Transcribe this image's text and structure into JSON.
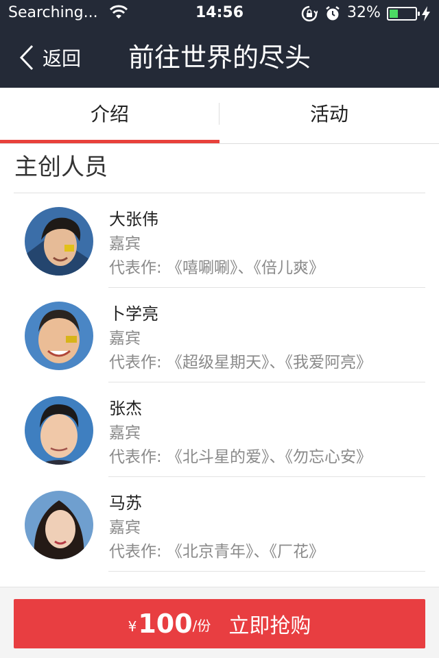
{
  "status_bar": {
    "carrier": "Searching...",
    "time": "14:56",
    "battery_percent": "32%",
    "battery_level": 0.32,
    "icons": [
      "wifi-icon",
      "rotation-lock-icon",
      "alarm-icon",
      "battery-icon",
      "charging-bolt-icon"
    ]
  },
  "nav": {
    "back_label": "返回",
    "title": "前往世界的尽头"
  },
  "tabs": [
    {
      "label": "介绍",
      "selected": true
    },
    {
      "label": "活动",
      "selected": false
    }
  ],
  "accent_color": "#e8413b",
  "section": {
    "title": "主创人员",
    "members": [
      {
        "name": "大张伟",
        "role": "嘉宾",
        "works": "代表作: 《嘻唰唰》、《倍儿爽》"
      },
      {
        "name": "卜学亮",
        "role": "嘉宾",
        "works": "代表作: 《超级星期天》、《我爱阿亮》"
      },
      {
        "name": "张杰",
        "role": "嘉宾",
        "works": "代表作: 《北斗星的爱》、《勿忘心安》"
      },
      {
        "name": "马苏",
        "role": "嘉宾",
        "works": "代表作: 《北京青年》、《厂花》"
      }
    ]
  },
  "buy": {
    "currency": "¥",
    "price": "100",
    "unit": "/份",
    "label": "立即抢购"
  }
}
